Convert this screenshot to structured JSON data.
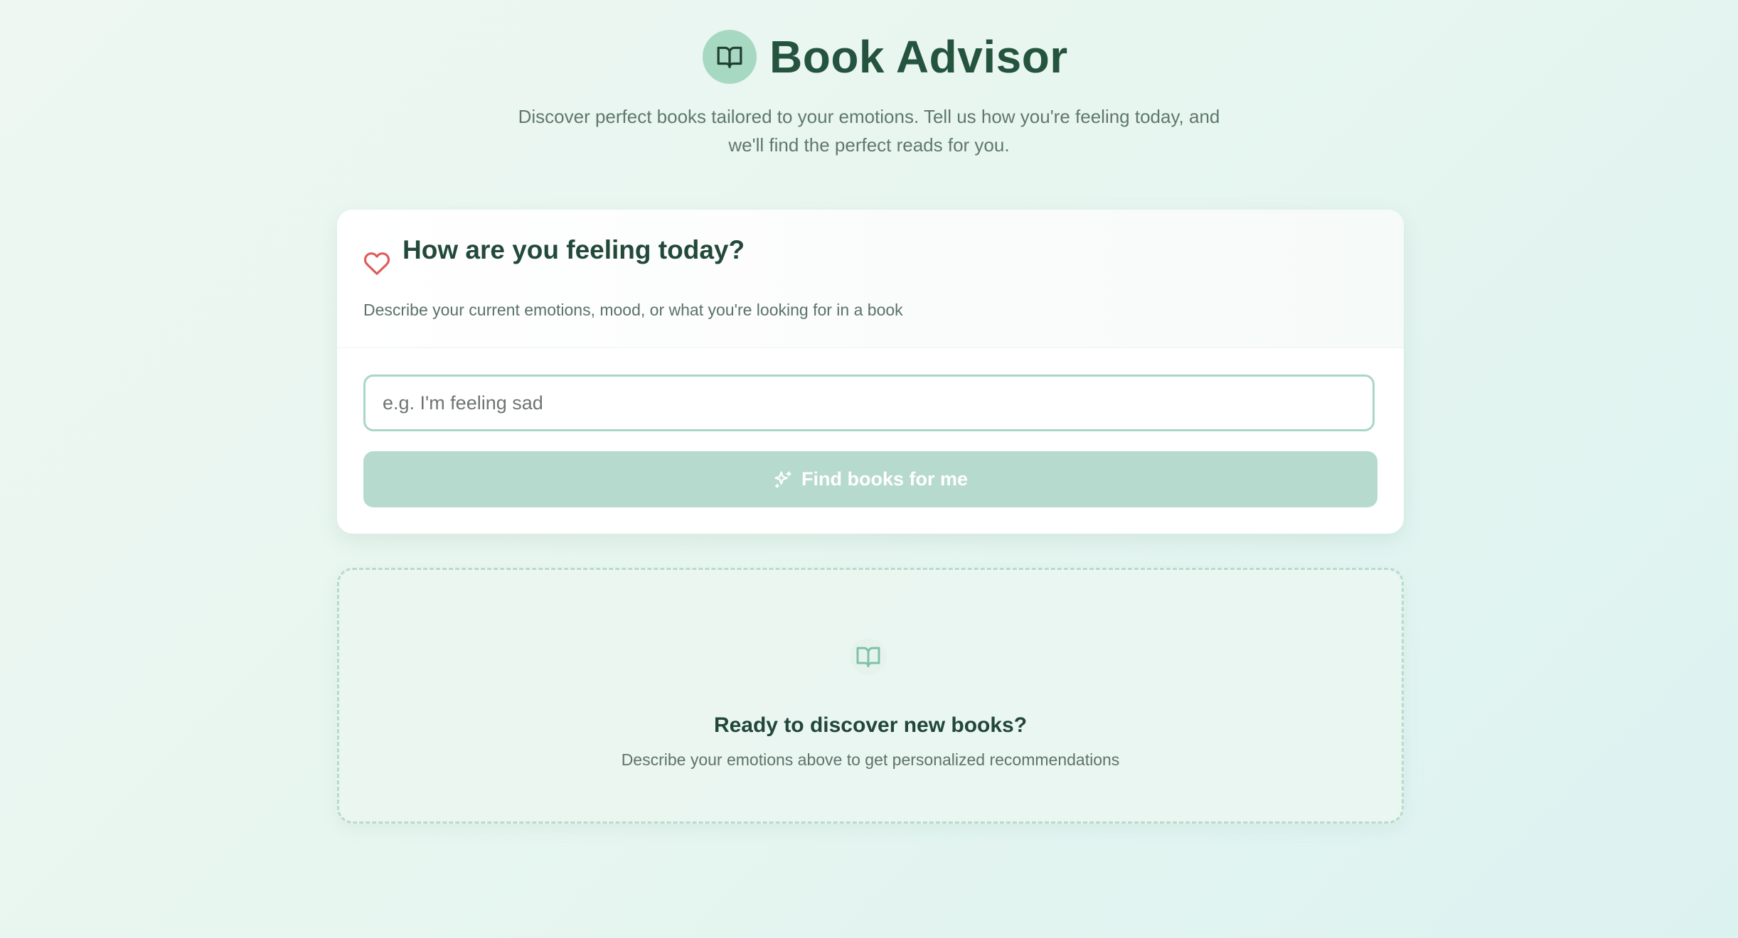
{
  "header": {
    "title": "Book Advisor",
    "subtitle": "Discover perfect books tailored to your emotions. Tell us how you're feeling today, and we'll find the perfect reads for you.",
    "logo_icon": "book-open-icon"
  },
  "feeling_card": {
    "title": "How are you feeling today?",
    "description": "Describe your current emotions, mood, or what you're looking for in a book",
    "title_icon": "heart-icon",
    "input_placeholder": "e.g. I'm feeling sad",
    "input_value": "",
    "button_label": "Find books for me",
    "button_icon": "sparkles-icon"
  },
  "empty_state": {
    "icon": "book-open-icon",
    "title": "Ready to discover new books?",
    "description": "Describe your emotions above to get personalized recommendations"
  },
  "colors": {
    "brand": "#24533e",
    "accent": "#a7d8c2",
    "button_disabled": "#b7dace",
    "heart": "#e05a5a"
  }
}
